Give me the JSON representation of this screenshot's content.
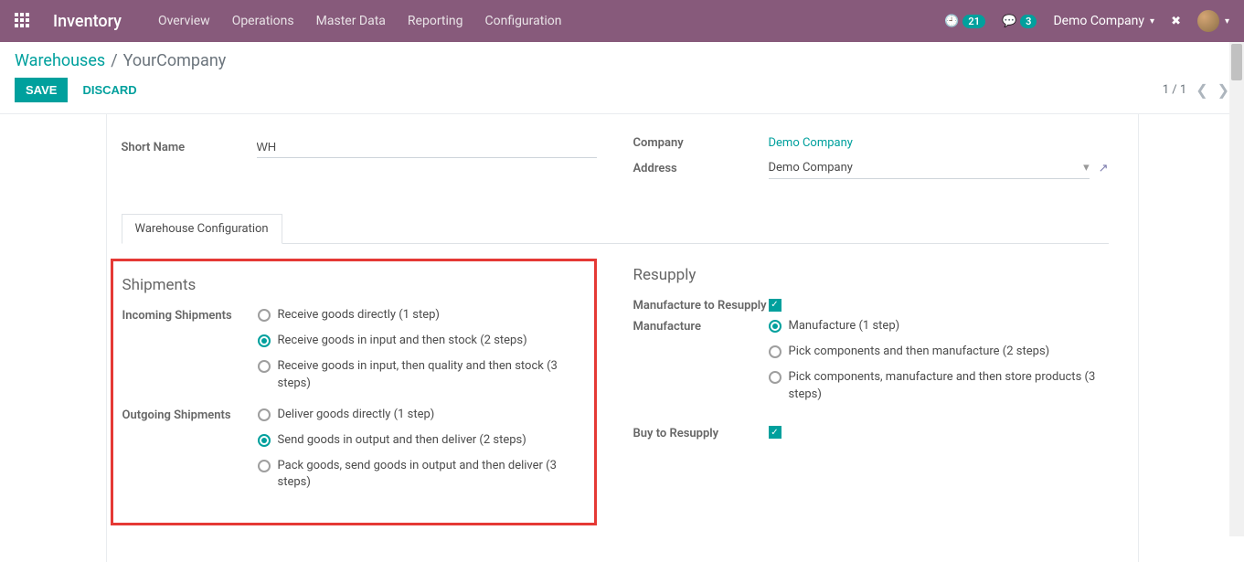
{
  "navbar": {
    "brand": "Inventory",
    "links": [
      "Overview",
      "Operations",
      "Master Data",
      "Reporting",
      "Configuration"
    ],
    "activity_count": "21",
    "message_count": "3",
    "company": "Demo Company"
  },
  "breadcrumb": {
    "parent": "Warehouses",
    "current": "YourCompany"
  },
  "actions": {
    "save": "SAVE",
    "discard": "DISCARD",
    "pager": "1 / 1"
  },
  "form": {
    "short_name_label": "Short Name",
    "short_name_value": "WH",
    "company_label": "Company",
    "company_value": "Demo Company",
    "address_label": "Address",
    "address_value": "Demo Company"
  },
  "tab": {
    "label": "Warehouse Configuration"
  },
  "shipments": {
    "title": "Shipments",
    "incoming_label": "Incoming Shipments",
    "incoming_options": [
      "Receive goods directly (1 step)",
      "Receive goods in input and then stock (2 steps)",
      "Receive goods in input, then quality and then stock (3 steps)"
    ],
    "incoming_selected": 1,
    "outgoing_label": "Outgoing Shipments",
    "outgoing_options": [
      "Deliver goods directly (1 step)",
      "Send goods in output and then deliver (2 steps)",
      "Pack goods, send goods in output and then deliver (3 steps)"
    ],
    "outgoing_selected": 1
  },
  "resupply": {
    "title": "Resupply",
    "mfg_to_resupply_label": "Manufacture to Resupply",
    "mfg_to_resupply_checked": true,
    "manufacture_label": "Manufacture",
    "manufacture_options": [
      "Manufacture (1 step)",
      "Pick components and then manufacture (2 steps)",
      "Pick components, manufacture and then store products (3 steps)"
    ],
    "manufacture_selected": 0,
    "buy_label": "Buy to Resupply",
    "buy_checked": true
  }
}
